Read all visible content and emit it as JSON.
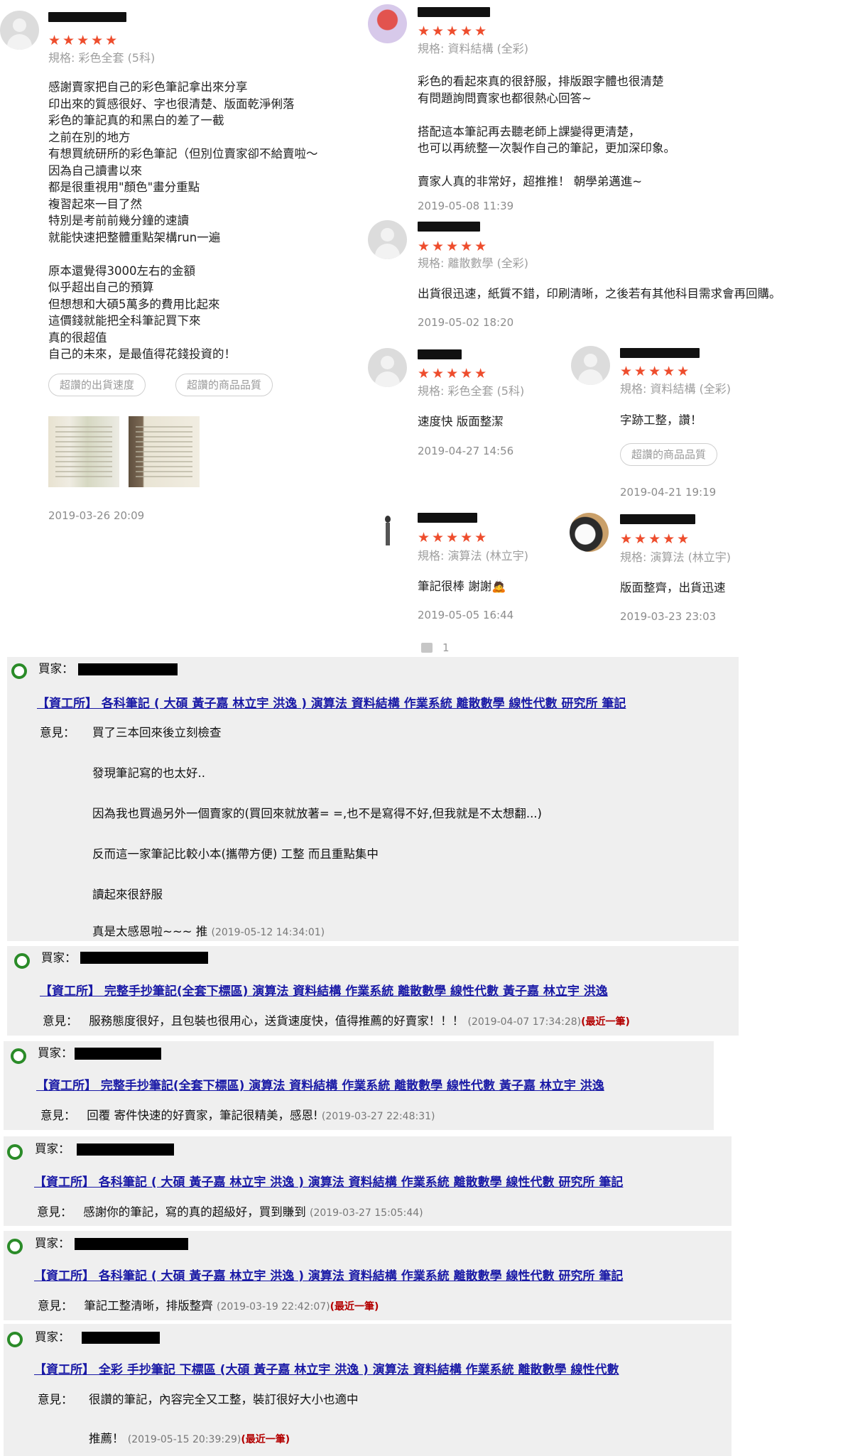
{
  "reviews": [
    {
      "username": "",
      "stars": "★★★★★",
      "spec": "規格: 彩色全套 (5科)",
      "body": "感謝賣家把自己的彩色筆記拿出來分享\n印出來的質感很好、字也很清楚、版面乾淨俐落\n彩色的筆記真的和黑白的差了一截\n之前在別的地方\n有想買統研所的彩色筆記（但別位賣家卻不給賣啦～\n因為自己讀書以來\n都是很重視用\"顏色\"畫分重點\n複習起來一目了然\n特別是考前前幾分鐘的速讀\n就能快速把整體重點架構run一遍\n\n原本還覺得3000左右的金額\n似乎超出自己的預算\n但想想和大碩5萬多的費用比起來\n這價錢就能把全科筆記買下來\n真的很超值\n自己的未來，是最值得花錢投資的！",
      "tags": [
        "超讚的出貨速度",
        "超讚的商品品質"
      ],
      "date": "2019-03-26 20:09"
    },
    {
      "username": "",
      "stars": "★★★★★",
      "spec": "規格: 資料結構 (全彩)",
      "body": "彩色的看起來真的很舒服，排版跟字體也很清楚\n有問題詢問賣家也都很熱心回答~\n\n搭配這本筆記再去聽老師上課變得更清楚，\n也可以再統整一次製作自己的筆記，更加深印象。\n\n賣家人真的非常好，超推推！ 朝學弟邁進~",
      "tags": [],
      "date": "2019-05-08 11:39"
    },
    {
      "username": "",
      "stars": "★★★★★",
      "spec": "規格: 離散數學 (全彩)",
      "body": "出貨很迅速，紙質不錯，印刷清晰，之後若有其他科目需求會再回購。",
      "tags": [],
      "date": "2019-05-02 18:20"
    },
    {
      "username": "",
      "stars": "★★★★★",
      "spec": "規格: 彩色全套 (5科)",
      "body": "速度快 版面整潔",
      "tags": [],
      "date": "2019-04-27 14:56"
    },
    {
      "username": "",
      "stars": "★★★★★",
      "spec": "規格: 資料結構 (全彩)",
      "body": "字跡工整，讚！",
      "tags": [
        "超讚的商品品質"
      ],
      "date": "2019-04-21 19:19"
    },
    {
      "username": "",
      "stars": "★★★★★",
      "spec": "規格: 演算法 (林立宇)",
      "body": "筆記很棒 謝謝🙇",
      "tags": [],
      "date": "2019-05-05 16:44"
    },
    {
      "username": "",
      "stars": "★★★★★",
      "spec": "規格: 演算法 (林立宇)",
      "body": "版面整齊，出貨迅速",
      "tags": [],
      "date": "2019-03-23 23:03"
    }
  ],
  "like_count": "1",
  "buyers": [
    {
      "label": "買家：",
      "product": "【資工所】 各科筆記 ( 大碩 黃子嘉 林立宇 洪逸 ) 演算法 資料結構 作業系統 離散數學 線性代數 研究所 筆記",
      "opinion_label": "意見：",
      "lines": [
        "買了三本回來後立刻檢查",
        "發現筆記寫的也太好..",
        "因為我也買過另外一個賣家的(買回來就放著= =,也不是寫得不好,但我就是不太想翻...)",
        "反而這一家筆記比較小本(攜帶方便) 工整 而且重點集中",
        "讀起來很舒服",
        "真是太感恩啦~~~ 推"
      ],
      "timestamp": "(2019-05-12 14:34:01)",
      "recent": ""
    },
    {
      "label": "買家：",
      "product": "【資工所】 完整手抄筆記(全套下標區) 演算法 資料結構 作業系統 離散數學 線性代數 黃子嘉 林立宇 洪逸",
      "opinion_label": "意見：",
      "lines": [
        "服務態度很好，且包裝也很用心，送貨速度快，值得推薦的好賣家！！！"
      ],
      "timestamp": "(2019-04-07 17:34:28)",
      "recent": "(最近一筆)"
    },
    {
      "label": "買家：",
      "product": "【資工所】 完整手抄筆記(全套下標區) 演算法 資料結構 作業系統 離散數學 線性代數 黃子嘉 林立宇 洪逸",
      "opinion_label": "意見：",
      "lines": [
        "回覆 寄件快速的好賣家，筆記很精美，感恩!"
      ],
      "timestamp": "(2019-03-27 22:48:31)",
      "recent": ""
    },
    {
      "label": "買家：",
      "product": "【資工所】 各科筆記 ( 大碩 黃子嘉 林立宇 洪逸 ) 演算法 資料結構 作業系統 離散數學 線性代數 研究所 筆記",
      "opinion_label": "意見：",
      "lines": [
        "感謝你的筆記，寫的真的超級好，買到賺到"
      ],
      "timestamp": "(2019-03-27 15:05:44)",
      "recent": ""
    },
    {
      "label": "買家：",
      "product": "【資工所】 各科筆記 ( 大碩 黃子嘉 林立宇 洪逸 ) 演算法 資料結構 作業系統 離散數學 線性代數 研究所 筆記",
      "opinion_label": "意見：",
      "lines": [
        "筆記工整清晰，排版整齊"
      ],
      "timestamp": "(2019-03-19 22:42:07)",
      "recent": "(最近一筆)"
    },
    {
      "label": "買家：",
      "product": "【資工所】 全彩 手抄筆記 下標區 (大碩 黃子嘉 林立宇 洪逸 ) 演算法 資料結構 作業系統 離散數學 線性代數",
      "opinion_label": "意見：",
      "lines": [
        "很讚的筆記，內容完全又工整，裝訂很好大小也適中",
        "推薦！"
      ],
      "timestamp": "(2019-05-15 20:39:29)",
      "recent": "(最近一筆)"
    }
  ],
  "colors": {
    "star": "#ee4d2d",
    "link": "#1a1aa6",
    "recent": "#b30000",
    "dot": "#2a8b28",
    "buyer_bg": "#efefef"
  }
}
